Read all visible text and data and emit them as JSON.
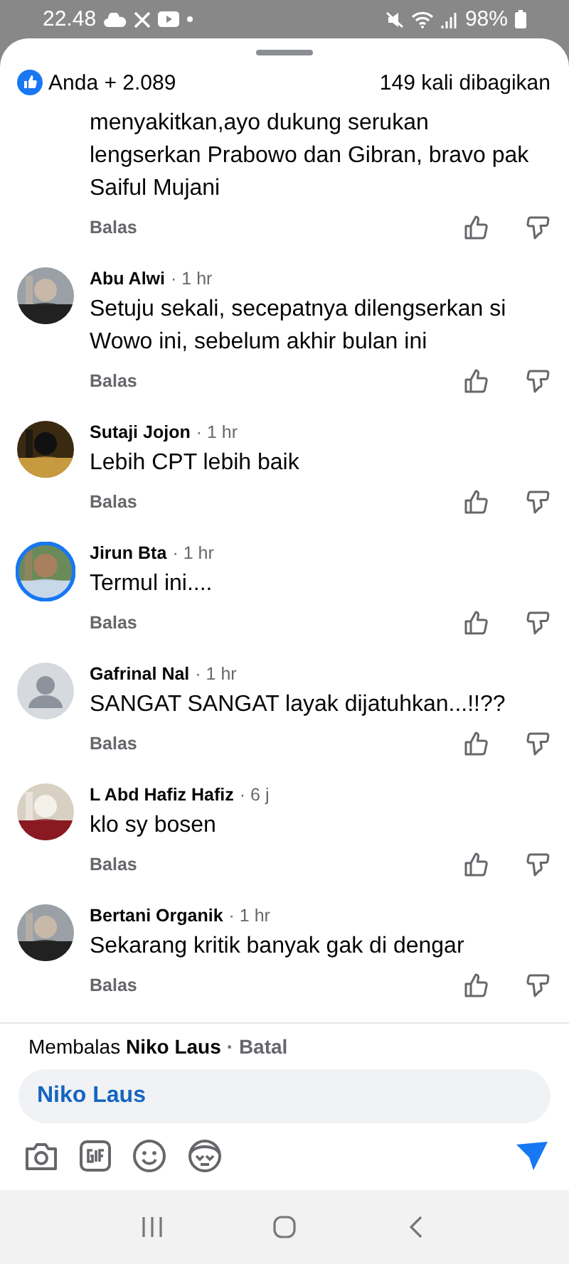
{
  "status_bar": {
    "time": "22.48",
    "battery": "98%"
  },
  "header": {
    "reactions": "Anda + 2.089",
    "shares": "149 kali dibagikan"
  },
  "comments": [
    {
      "kind": "continued",
      "text": "menyakitkan,ayo dukung serukan lengserkan Prabowo dan Gibran, bravo pak Saiful Mujani",
      "reply": "Balas"
    },
    {
      "ring": false,
      "name": "Abu Alwi",
      "time": "· 1 hr",
      "text": "Setuju sekali, secepatnya dilengserkan si Wowo ini, sebelum akhir bulan ini",
      "reply": "Balas"
    },
    {
      "ring": false,
      "name": "Sutaji Jojon",
      "time": "· 1 hr",
      "text": "Lebih CPT lebih baik",
      "reply": "Balas"
    },
    {
      "ring": true,
      "name": "Jirun Bta",
      "time": "· 1 hr",
      "text": "Termul ini....",
      "reply": "Balas"
    },
    {
      "kind": "default",
      "ring": false,
      "name": "Gafrinal Nal",
      "time": "· 1 hr",
      "text": "SANGAT SANGAT layak dijatuhkan...!!??",
      "reply": "Balas"
    },
    {
      "ring": false,
      "name": "L Abd Hafiz Hafiz",
      "time": "· 6 j",
      "text": "klo sy bosen",
      "reply": "Balas"
    },
    {
      "ring": false,
      "name": "Bertani Organik",
      "time": "· 1 hr",
      "text": "Sekarang kritik banyak gak di dengar",
      "reply": "Balas"
    }
  ],
  "reply_bar": {
    "prefix": "Membalas",
    "name": "Niko Laus",
    "cancel": "· Batal",
    "value": "Niko Laus"
  }
}
